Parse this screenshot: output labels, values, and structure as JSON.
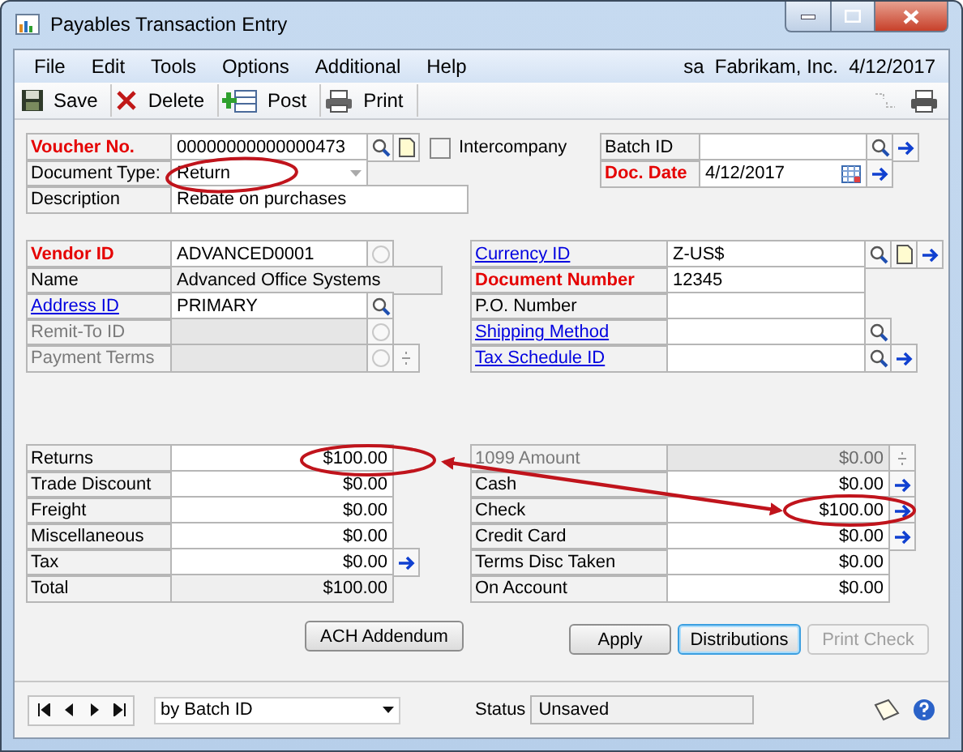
{
  "window": {
    "title": "Payables Transaction Entry"
  },
  "menu": [
    "File",
    "Edit",
    "Tools",
    "Options",
    "Additional",
    "Help"
  ],
  "session": {
    "user": "sa",
    "company": "Fabrikam, Inc.",
    "date": "4/12/2017"
  },
  "toolbar": [
    {
      "kind": "save",
      "label": "Save"
    },
    {
      "kind": "delete",
      "label": "Delete"
    },
    {
      "kind": "post",
      "label": "Post"
    },
    {
      "kind": "print",
      "label": "Print"
    }
  ],
  "header_left": [
    {
      "label": "Voucher No.",
      "required": true,
      "value": "00000000000000473",
      "kind": "text",
      "lookup_button": true,
      "note_button": true
    },
    {
      "label": "Document Type:",
      "value": "Return",
      "kind": "dropdown"
    },
    {
      "label": "Description",
      "value": "Rebate on purchases",
      "kind": "wide"
    }
  ],
  "intercompany": {
    "label": "Intercompany",
    "checked": false
  },
  "header_right": [
    {
      "label": "Batch ID",
      "kind": "text",
      "lookup_button": true,
      "arrow_button": true
    },
    {
      "label": "Doc. Date",
      "required": true,
      "value": "4/12/2017",
      "kind": "date",
      "arrow_button": true
    }
  ],
  "vendor_fields": [
    {
      "label": "Vendor ID",
      "required": true,
      "value": "ADVANCED0001",
      "kind": "text",
      "radio": true
    },
    {
      "label": "Name",
      "value": "Advanced Office Systems",
      "kind": "wide",
      "read_only": true
    },
    {
      "label": "Address ID",
      "link": true,
      "value": "PRIMARY",
      "kind": "text",
      "lookup_button": true
    },
    {
      "label": "Remit-To ID",
      "kind": "text",
      "disabled": true,
      "radio": true
    },
    {
      "label": "Payment Terms",
      "kind": "text",
      "disabled": true,
      "radio": true,
      "spinner": true
    }
  ],
  "document_fields": [
    {
      "label": "Currency ID",
      "link": true,
      "value": "Z-US$",
      "kind": "text",
      "lookup_button": true,
      "note_button": true,
      "arrow_button": true
    },
    {
      "label": "Document Number",
      "required": true,
      "value": "12345",
      "kind": "text"
    },
    {
      "label": "P.O. Number",
      "kind": "text"
    },
    {
      "label": "Shipping Method",
      "link": true,
      "kind": "text",
      "lookup_button": true
    },
    {
      "label": "Tax Schedule ID",
      "link": true,
      "kind": "text",
      "lookup_button": true,
      "arrow_button": true
    }
  ],
  "amounts_left": [
    {
      "label": "Returns",
      "value": "$100.00",
      "kind": "amount"
    },
    {
      "label": "Trade Discount",
      "value": "$0.00",
      "kind": "amount"
    },
    {
      "label": "Freight",
      "value": "$0.00",
      "kind": "amount"
    },
    {
      "label": "Miscellaneous",
      "value": "$0.00",
      "kind": "amount"
    },
    {
      "label": "Tax",
      "value": "$0.00",
      "kind": "amount",
      "arrow_button": true
    },
    {
      "label": "Total",
      "value": "$100.00",
      "kind": "amount",
      "read_only": true
    }
  ],
  "amounts_right": [
    {
      "label": "1099 Amount",
      "value": "$0.00",
      "kind": "amount",
      "disabled": true,
      "spinner": true
    },
    {
      "label": "Cash",
      "value": "$0.00",
      "kind": "amount",
      "arrow_button": true
    },
    {
      "label": "Check",
      "value": "$100.00",
      "kind": "amount",
      "arrow_button": true
    },
    {
      "label": "Credit Card",
      "value": "$0.00",
      "kind": "amount",
      "arrow_button": true
    },
    {
      "label": "Terms Disc Taken",
      "value": "$0.00",
      "kind": "amount"
    },
    {
      "label": "On Account",
      "value": "$0.00",
      "kind": "amount"
    }
  ],
  "ach_button": "ACH Addendum",
  "actions": [
    {
      "label": "Apply",
      "focused": false,
      "disabled": false
    },
    {
      "label": "Distributions",
      "focused": true,
      "disabled": false
    },
    {
      "label": "Print Check",
      "focused": false,
      "disabled": true
    }
  ],
  "browse": {
    "sort": "by Batch ID"
  },
  "status": {
    "label": "Status",
    "value": "Unsaved"
  }
}
